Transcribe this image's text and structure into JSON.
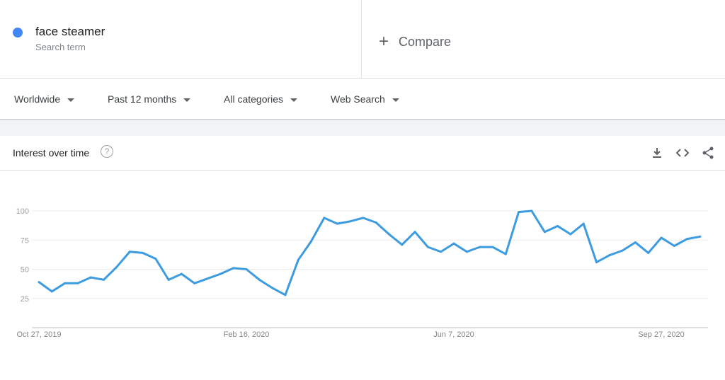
{
  "search_term": {
    "name": "face steamer",
    "subtitle": "Search term",
    "color": "#4285f4"
  },
  "compare": {
    "icon": "plus-icon",
    "label": "Compare"
  },
  "filters": [
    {
      "label": "Worldwide"
    },
    {
      "label": "Past 12 months"
    },
    {
      "label": "All categories"
    },
    {
      "label": "Web Search"
    }
  ],
  "card": {
    "title": "Interest over time",
    "help_icon": "?",
    "tools": [
      "download-icon",
      "embed-icon",
      "share-icon"
    ]
  },
  "chart_data": {
    "type": "line",
    "title": "",
    "xlabel": "",
    "ylabel": "",
    "ylim": [
      0,
      100
    ],
    "yticks": [
      25,
      50,
      75,
      100
    ],
    "xtick_labels": [
      "Oct 27, 2019",
      "Feb 16, 2020",
      "Jun 7, 2020",
      "Sep 27, 2020"
    ],
    "grid": true,
    "line_color": "#3d9be0",
    "series": [
      {
        "name": "face steamer",
        "x": [
          "2019-10-27",
          "2019-11-03",
          "2019-11-10",
          "2019-11-17",
          "2019-11-24",
          "2019-12-01",
          "2019-12-08",
          "2019-12-15",
          "2019-12-22",
          "2019-12-29",
          "2020-01-05",
          "2020-01-12",
          "2020-01-19",
          "2020-01-26",
          "2020-02-02",
          "2020-02-09",
          "2020-02-16",
          "2020-02-23",
          "2020-03-01",
          "2020-03-08",
          "2020-03-15",
          "2020-03-22",
          "2020-03-29",
          "2020-04-05",
          "2020-04-12",
          "2020-04-19",
          "2020-04-26",
          "2020-05-03",
          "2020-05-10",
          "2020-05-17",
          "2020-05-24",
          "2020-05-31",
          "2020-06-07",
          "2020-06-14",
          "2020-06-21",
          "2020-06-28",
          "2020-07-05",
          "2020-07-12",
          "2020-07-19",
          "2020-07-26",
          "2020-08-02",
          "2020-08-09",
          "2020-08-16",
          "2020-08-23",
          "2020-08-30",
          "2020-09-06",
          "2020-09-13",
          "2020-09-20",
          "2020-09-27",
          "2020-10-04",
          "2020-10-11",
          "2020-10-18"
        ],
        "values": [
          39,
          31,
          38,
          38,
          43,
          41,
          52,
          65,
          64,
          59,
          41,
          46,
          38,
          42,
          46,
          51,
          50,
          41,
          34,
          28,
          58,
          74,
          94,
          89,
          91,
          94,
          90,
          80,
          71,
          82,
          69,
          65,
          72,
          65,
          69,
          69,
          63,
          99,
          100,
          82,
          87,
          80,
          89,
          56,
          62,
          66,
          73,
          64,
          77,
          70,
          76,
          78
        ]
      }
    ]
  }
}
